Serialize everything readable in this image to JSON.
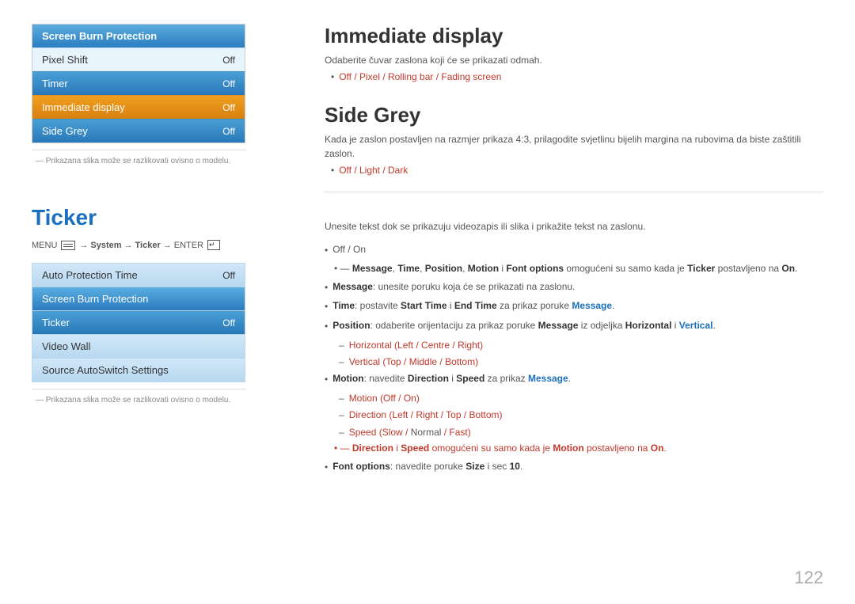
{
  "page": {
    "number": "122"
  },
  "top_menu": {
    "title": "Screen Burn Protection",
    "items": [
      {
        "label": "Pixel Shift",
        "value": "Off",
        "style": "light"
      },
      {
        "label": "Timer",
        "value": "Off",
        "style": "dark"
      },
      {
        "label": "Immediate display",
        "value": "Off",
        "style": "active"
      },
      {
        "label": "Side Grey",
        "value": "Off",
        "style": "dark"
      }
    ],
    "note": "Prikazana slika može se razlikovati ovisno o modelu."
  },
  "immediate_display": {
    "title": "Immediate display",
    "desc": "Odaberite čuvar zaslona koji će se prikazati odmah.",
    "options": "Off / Pixel / Rolling bar / Fading screen"
  },
  "side_grey": {
    "title": "Side Grey",
    "desc": "Kada je zaslon postavljen na razmjer prikaza 4:3, prilagodite svjetlinu bijelih margina na rubovima da biste zaštitili zaslon.",
    "options": "Off / Light / Dark"
  },
  "ticker_section": {
    "heading": "Ticker",
    "nav": {
      "menu_label": "MENU",
      "arrow1": "→",
      "system": "System",
      "arrow2": "→",
      "ticker": "Ticker",
      "arrow3": "→",
      "enter": "ENTER"
    }
  },
  "ticker_menu": {
    "items": [
      {
        "label": "Auto Protection Time",
        "value": "Off",
        "style": "blue-light"
      },
      {
        "label": "Screen Burn Protection",
        "value": "",
        "style": "blue-med"
      },
      {
        "label": "Ticker",
        "value": "Off",
        "style": "blue-dark"
      },
      {
        "label": "Video Wall",
        "value": "",
        "style": "blue-light"
      },
      {
        "label": "Source AutoSwitch Settings",
        "value": "",
        "style": "blue-light"
      }
    ],
    "note": "Prikazana slika može se razlikovati ovisno o modelu."
  },
  "ticker_content": {
    "desc": "Unesite tekst dok se prikazuju videozapis ili slika i prikažite tekst na zaslonu.",
    "bullets": [
      {
        "text_parts": [
          {
            "text": "Off / On",
            "style": "normal"
          }
        ],
        "sub": [
          "Message, Time, Position, Motion i Font options omogućeni su samo kada je Ticker postavljeno na On."
        ]
      },
      {
        "text_parts": [
          {
            "text": "Message",
            "style": "bold"
          },
          {
            "text": ": unesite poruku koja će se prikazati na zaslonu.",
            "style": "normal"
          }
        ]
      },
      {
        "text_parts": [
          {
            "text": "Time",
            "style": "bold"
          },
          {
            "text": ": postavite ",
            "style": "normal"
          },
          {
            "text": "Start Time",
            "style": "bold"
          },
          {
            "text": " i ",
            "style": "normal"
          },
          {
            "text": "End Time",
            "style": "bold"
          },
          {
            "text": " za prikaz poruke ",
            "style": "normal"
          },
          {
            "text": "Message",
            "style": "bold-blue"
          },
          {
            "text": ".",
            "style": "normal"
          }
        ]
      },
      {
        "text_parts": [
          {
            "text": "Position",
            "style": "bold"
          },
          {
            "text": ": odaberite orijentaciju za prikaz poruke ",
            "style": "normal"
          },
          {
            "text": "Message",
            "style": "bold"
          },
          {
            "text": " iz odjeljka ",
            "style": "normal"
          },
          {
            "text": "Horizontal",
            "style": "bold"
          },
          {
            "text": " i ",
            "style": "normal"
          },
          {
            "text": "Vertical",
            "style": "bold-blue"
          },
          {
            "text": ".",
            "style": "normal"
          }
        ],
        "sub": [
          "Horizontal (Left / Centre / Right)",
          "Vertical (Top / Middle / Bottom)"
        ]
      },
      {
        "text_parts": [
          {
            "text": "Motion",
            "style": "bold"
          },
          {
            "text": ": navedite ",
            "style": "normal"
          },
          {
            "text": "Direction",
            "style": "bold"
          },
          {
            "text": " i ",
            "style": "normal"
          },
          {
            "text": "Speed",
            "style": "bold"
          },
          {
            "text": " za prikaz ",
            "style": "normal"
          },
          {
            "text": "Message",
            "style": "bold-blue"
          },
          {
            "text": ".",
            "style": "normal"
          }
        ],
        "sub": [
          "Motion (Off / On)",
          "Direction (Left / Right / Top / Bottom)",
          "Speed (Slow / Normal / Fast)"
        ],
        "sub2": "Direction i Speed omogućeni su samo kada je Motion postavljeno na On."
      },
      {
        "text_parts": [
          {
            "text": "Font options",
            "style": "bold"
          },
          {
            "text": ": navedite poruke ",
            "style": "normal"
          },
          {
            "text": "Size",
            "style": "bold"
          },
          {
            "text": " i sec ",
            "style": "normal"
          },
          {
            "text": "10",
            "style": "bold"
          },
          {
            "text": ".",
            "style": "normal"
          }
        ]
      }
    ]
  }
}
